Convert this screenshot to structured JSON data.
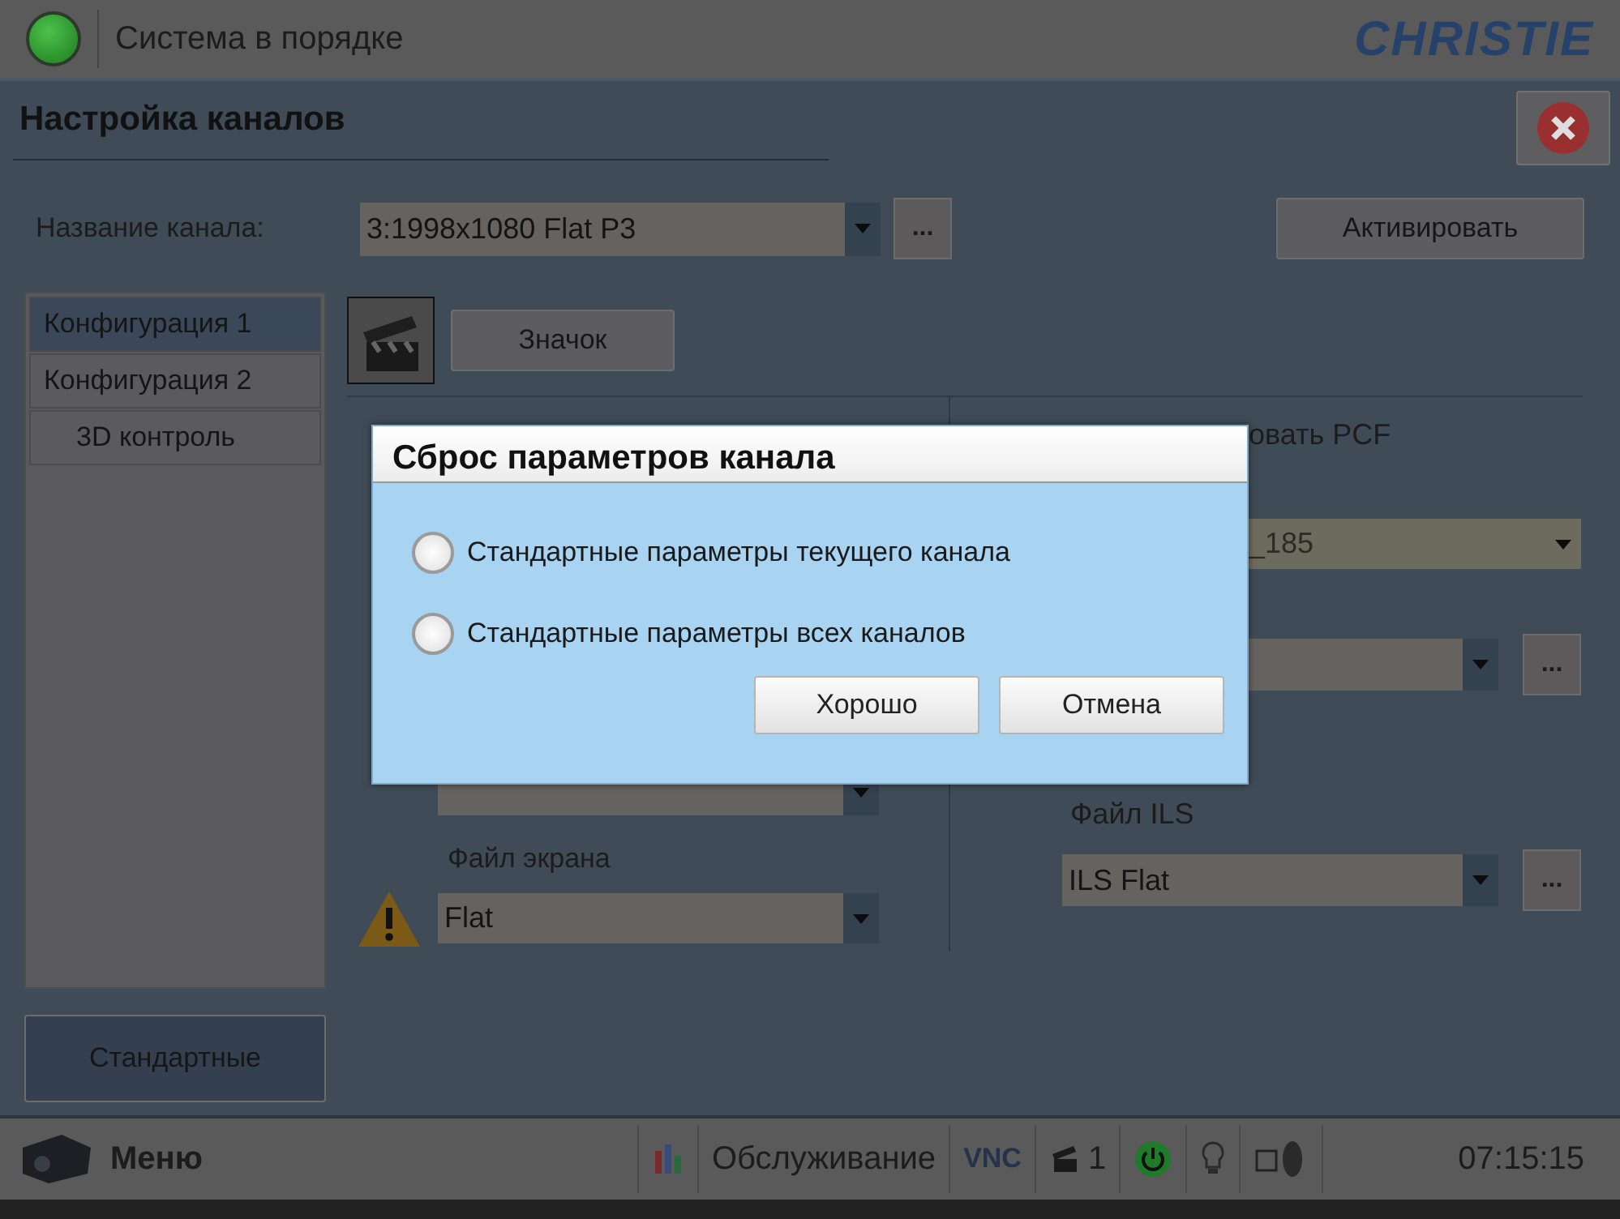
{
  "status": {
    "text": "Система в порядке",
    "ok": true
  },
  "logo": "CHRISTIE",
  "page_title": "Настройка каналов",
  "channel": {
    "label": "Название канала:",
    "value": "3:1998x1080 Flat P3",
    "browse": "..."
  },
  "activate_button": "Активировать",
  "config_tabs": [
    {
      "label": "Конфигурация 1",
      "selected": true
    },
    {
      "label": "Конфигурация 2",
      "selected": false
    },
    {
      "label": "3D контроль",
      "selected": false
    }
  ],
  "defaults_button": "Стандартные",
  "icon_button": "Значок",
  "screen_file": {
    "label": "Файл экрана",
    "value": "Flat",
    "warning": true
  },
  "right": {
    "pcf_label": "овать PCF",
    "lens_value": "_185",
    "lens_disabled": true,
    "browse": "...",
    "ils": {
      "label": "Файл ILS",
      "value": "ILS Flat",
      "browse": "..."
    }
  },
  "dialog": {
    "title": "Сброс параметров канала",
    "options": [
      {
        "label": "Стандартные параметры текущего канала",
        "selected": false
      },
      {
        "label": "Стандартные параметры всех каналов",
        "selected": false
      }
    ],
    "buttons": [
      "Хорошо",
      "Отмена"
    ]
  },
  "taskbar": {
    "menu": "Меню",
    "maintenance": "Обслуживание",
    "vnc": "VNC",
    "channel_count": "1",
    "power_on": true,
    "time": "07:15:15"
  }
}
